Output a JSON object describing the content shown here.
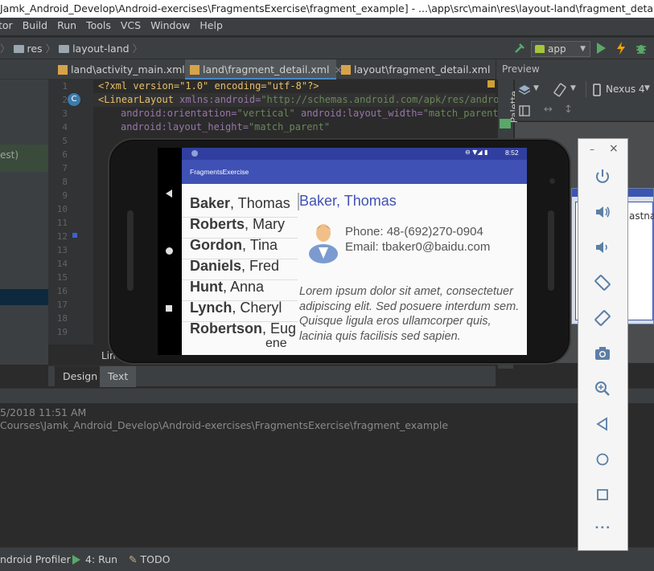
{
  "title_bar": {
    "text": "Jamk_Android_Develop\\Android-exercises\\FragmentsExercise\\fragment_example] - ...\\app\\src\\main\\res\\layout-land\\fragment_detail.xml [app] - Android"
  },
  "menu": [
    "tor",
    "Build",
    "Run",
    "Tools",
    "VCS",
    "Window",
    "Help"
  ],
  "breadcrumb": [
    "res",
    "layout-land"
  ],
  "run_config": "app",
  "editor_tabs": [
    {
      "label": "land\\activity_main.xml",
      "active": false
    },
    {
      "label": "land\\fragment_detail.xml",
      "active": true
    },
    {
      "label": "layout\\fragment_detail.xml",
      "active": false
    }
  ],
  "left_pane": {
    "label": "est)"
  },
  "line_numbers": [
    "1",
    "2",
    "3",
    "4",
    "5",
    "6",
    "7",
    "8",
    "9",
    "10",
    "11",
    "12",
    "13",
    "14",
    "15",
    "16",
    "17",
    "18",
    "19"
  ],
  "code": {
    "line1": "<?xml version=\"1.0\" encoding=\"utf-8\"?>",
    "line2_tag": "<LinearLayout",
    "line2_attr": " xmlns:android=",
    "line2_val": "\"http://schemas.android.com/apk/res/android\"",
    "line3_attr": "android:orientation=",
    "line3_val": "\"vertical\"",
    "line3_attr2": " android:layout_width=",
    "line3_val2": "\"match_parent\"",
    "line4_attr": "android:layout_height=",
    "line4_val": "\"match_parent\""
  },
  "preview": {
    "header": "Preview",
    "palette": "Palette",
    "device": "Nexus 4",
    "canvas_text": "astna"
  },
  "design_tabs": [
    "Design",
    "Text"
  ],
  "editor_partial_label": "Line",
  "log": {
    "timestamp": "5/2018 11:51 AM",
    "path": "Courses\\Jamk_Android_Develop\\Android-exercises\\FragmentsExercise\\fragment_example"
  },
  "tool_windows": [
    {
      "label": "ndroid Profiler",
      "icon": "profiler-icon"
    },
    {
      "label": "4: Run",
      "icon": "run-icon"
    },
    {
      "label": "TODO",
      "icon": "todo-icon"
    }
  ],
  "emulator": {
    "time": "8:52",
    "app_title": "FragmentsExercise",
    "people": [
      {
        "last": "Baker",
        "first": "Thomas"
      },
      {
        "last": "Roberts",
        "first": "Mary"
      },
      {
        "last": "Gordon",
        "first": "Tina"
      },
      {
        "last": "Daniels",
        "first": "Fred"
      },
      {
        "last": "Hunt",
        "first": "Anna"
      },
      {
        "last": "Lynch",
        "first": "Cheryl"
      },
      {
        "last": "Robertson",
        "first": "Eug"
      },
      {
        "last": "",
        "first": "ene"
      }
    ],
    "detail": {
      "name": "Baker, Thomas",
      "phone": "Phone: 48-(692)270-0904",
      "email": "Email: tbaker0@baidu.com",
      "lorem": "Lorem ipsum dolor sit amet, consectetuer adipiscing elit. Sed posuere interdum sem. Quisque ligula eros ullamcorper quis, lacinia quis facilisis sed sapien."
    },
    "panel_min": "–",
    "panel_close": "×",
    "controls": [
      "power-icon",
      "volume-up-icon",
      "volume-down-icon",
      "rotate-left-icon",
      "rotate-right-icon",
      "camera-icon",
      "zoom-icon",
      "back-icon",
      "home-icon",
      "overview-icon",
      "more-icon"
    ],
    "more_label": "•••"
  }
}
